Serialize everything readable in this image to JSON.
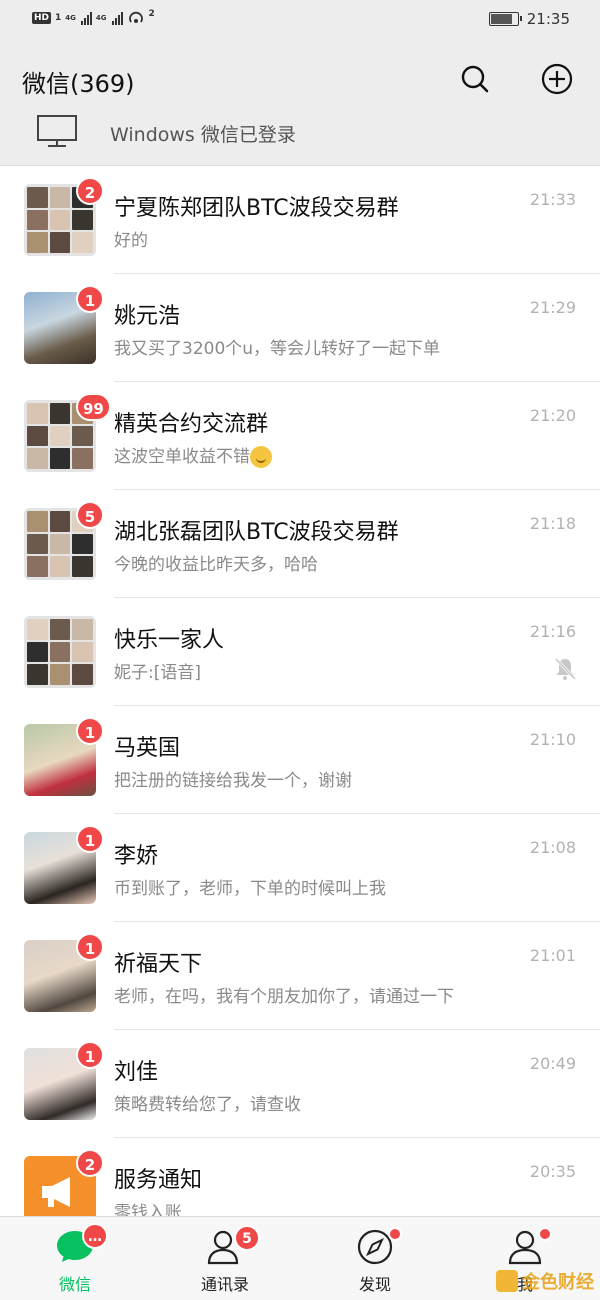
{
  "status_bar": {
    "hd": "HD",
    "sim1": "1",
    "net1": "4G",
    "net2": "4G",
    "hotspot_count": "2",
    "time": "21:35",
    "battery_level": 0.8
  },
  "header": {
    "title": "微信(369)",
    "search_icon": "search-icon",
    "add_icon": "plus-circle-icon"
  },
  "login_banner": {
    "text": "Windows 微信已登录",
    "icon": "monitor-icon"
  },
  "chats": [
    {
      "name": "宁夏陈郑团队BTC波段交易群",
      "message": "好的",
      "time": "21:33",
      "badge": "2",
      "avatar": "group",
      "muted": false
    },
    {
      "name": "姚元浩",
      "message": "我又买了3200个u，等会儿转好了一起下单",
      "time": "21:29",
      "badge": "1",
      "avatar": "photo",
      "muted": false
    },
    {
      "name": "精英合约交流群",
      "message": "这波空单收益不错",
      "emoji": "hug-emoji",
      "time": "21:20",
      "badge": "99",
      "avatar": "group",
      "muted": false
    },
    {
      "name": "湖北张磊团队BTC波段交易群",
      "message": "今晚的收益比昨天多，哈哈",
      "time": "21:18",
      "badge": "5",
      "avatar": "group",
      "muted": false
    },
    {
      "name": "快乐一家人",
      "message": "妮子:[语音]",
      "time": "21:16",
      "badge": "",
      "avatar": "group",
      "muted": true
    },
    {
      "name": "马英国",
      "message": "把注册的链接给我发一个，谢谢",
      "time": "21:10",
      "badge": "1",
      "avatar": "photo",
      "muted": false
    },
    {
      "name": "李娇",
      "message": "币到账了，老师，下单的时候叫上我",
      "time": "21:08",
      "badge": "1",
      "avatar": "photo",
      "muted": false
    },
    {
      "name": "祈福天下",
      "message": "老师，在吗，我有个朋友加你了，请通过一下",
      "time": "21:01",
      "badge": "1",
      "avatar": "photo",
      "muted": false
    },
    {
      "name": "刘佳",
      "message": "策略费转给您了，请查收",
      "time": "20:49",
      "badge": "1",
      "avatar": "photo",
      "muted": false
    },
    {
      "name": "服务通知",
      "message": "零钱入账",
      "time": "20:35",
      "badge": "2",
      "avatar": "service",
      "muted": false
    }
  ],
  "tabs": [
    {
      "label": "微信",
      "icon": "chat-bubble-icon",
      "badge": "…",
      "active": true
    },
    {
      "label": "通讯录",
      "icon": "contacts-icon",
      "badge": "5",
      "active": false
    },
    {
      "label": "发现",
      "icon": "compass-icon",
      "dot": true,
      "active": false
    },
    {
      "label": "我",
      "icon": "person-icon",
      "dot": true,
      "active": false
    }
  ],
  "watermark": {
    "text": "金色财经"
  },
  "colors": {
    "accent": "#07c160",
    "badge": "#f04848",
    "header_bg": "#ededed",
    "service_orange": "#f6902a"
  }
}
